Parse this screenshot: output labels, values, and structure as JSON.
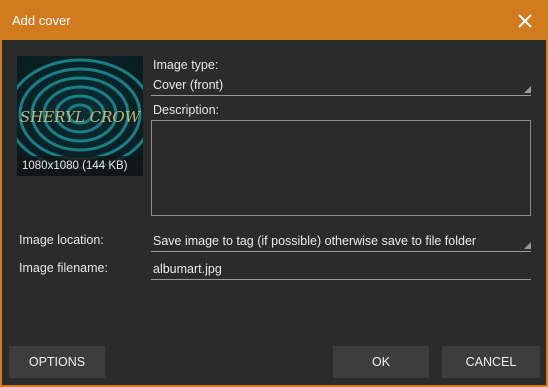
{
  "window": {
    "title": "Add cover"
  },
  "cover": {
    "art_text": "SHERYL CROW",
    "dimensions": "1080x1080 (144 KB)"
  },
  "image_type": {
    "label": "Image type:",
    "value": "Cover (front)"
  },
  "description": {
    "label": "Description:",
    "value": ""
  },
  "image_location": {
    "label": "Image location:",
    "value": "Save image to tag (if possible) otherwise save to file folder"
  },
  "image_filename": {
    "label": "Image filename:",
    "value": "albumart.jpg"
  },
  "buttons": {
    "options": "OPTIONS",
    "ok": "OK",
    "cancel": "CANCEL"
  },
  "colors": {
    "accent": "#d27a1e",
    "background": "#2b2b2b",
    "button": "#3d3d3d"
  }
}
